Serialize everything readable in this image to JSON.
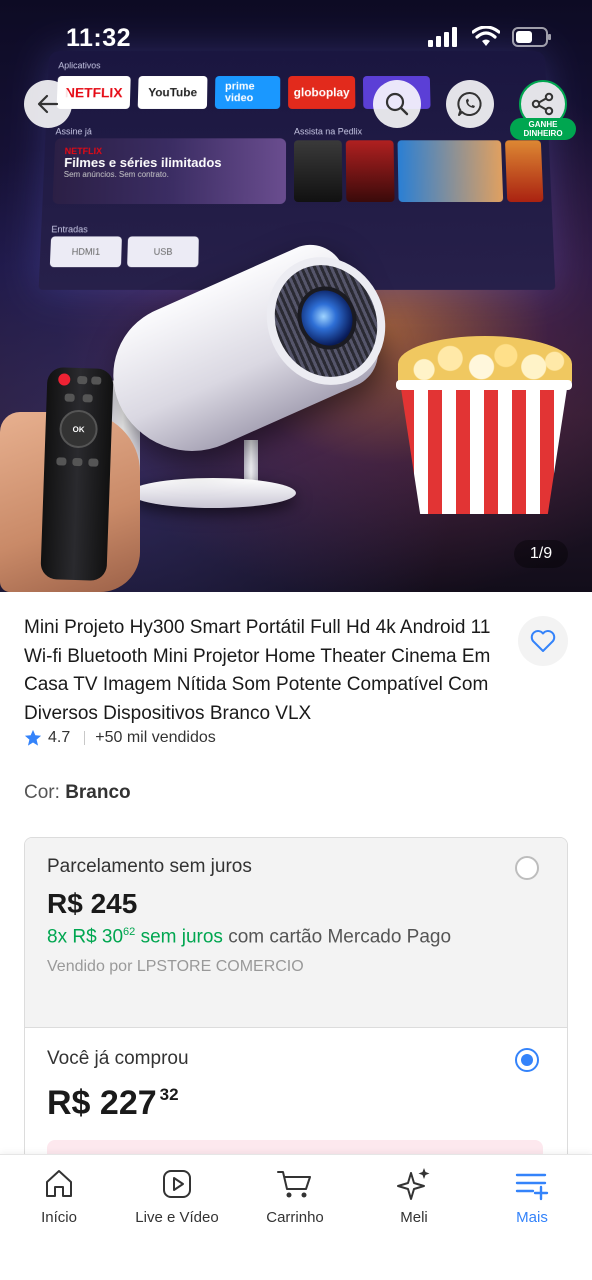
{
  "status_bar": {
    "time": "11:32"
  },
  "hero": {
    "image_counter": "1/9",
    "share_badge": "GANHE DINHEIRO",
    "tv_apps_label": "Aplicativos",
    "tv_apps": [
      "NETFLIX",
      "YouTube",
      "prime video",
      "globoplay"
    ],
    "tv_row2_label": "Assine já",
    "tv_row2b_label": "Assista na Pedlix",
    "feature_card": {
      "brand": "NETFLIX",
      "headline": "Filmes e séries ilimitados",
      "sub": "Sem anúncios. Sem contrato."
    },
    "tv_inputs_label": "Entradas",
    "tv_inputs": [
      "HDMI1",
      "USB"
    ],
    "remote_ok": "OK"
  },
  "product": {
    "title": "Mini Projeto Hy300 Smart Portátil Full Hd 4k Android 11 Wi-fi Bluetooth Mini Projetor Home Theater Cinema Em Casa TV Imagem Nítida Som Potente Compatível Com Diversos Dispositivos Branco VLX",
    "rating": "4.7",
    "sold": "+50 mil vendidos",
    "color_label": "Cor:",
    "color_value": "Branco"
  },
  "options": [
    {
      "title": "Parcelamento sem juros",
      "price": "R$ 245",
      "installments_prefix": "8x R$ 30",
      "installments_cents": "62",
      "installments_suffix": " sem juros",
      "installments_rest": " com cartão Mercado Pago",
      "seller": "Vendido por LPSTORE COMERCIO",
      "selected": false
    },
    {
      "title": "Você já comprou",
      "price": "R$ 227",
      "price_cents": "32",
      "selected": true
    }
  ],
  "bottom_nav": [
    {
      "label": "Início",
      "icon": "home-icon"
    },
    {
      "label": "Live e Vídeo",
      "icon": "play-icon"
    },
    {
      "label": "Carrinho",
      "icon": "cart-icon"
    },
    {
      "label": "Meli",
      "icon": "sparkle-icon"
    },
    {
      "label": "Mais",
      "icon": "menu-plus-icon",
      "active": true
    }
  ],
  "colors": {
    "accent": "#3483fa",
    "green": "#00a650",
    "text": "#1a1a1a",
    "muted": "#999999"
  }
}
